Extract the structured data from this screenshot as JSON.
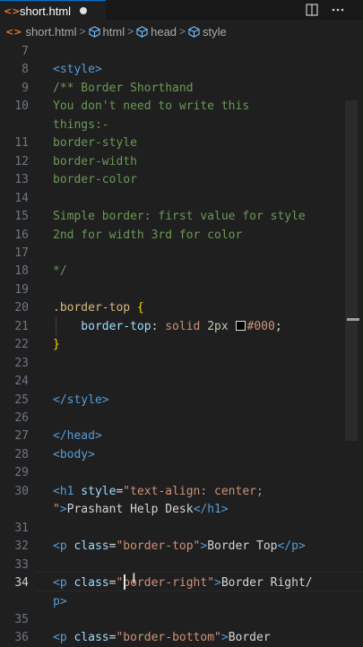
{
  "tab": {
    "filename": "short.html",
    "file_icon": "<>",
    "dirty": true
  },
  "toolbar": {
    "split_icon": "split-editor-icon",
    "more_icon": "more-actions-icon"
  },
  "breadcrumb": {
    "file_icon": "<>",
    "items": [
      "short.html",
      "html",
      "head",
      "style"
    ],
    "separator": ">"
  },
  "colors": {
    "tag": "#569cd6",
    "comment": "#6a9955",
    "selector": "#d7ba7d",
    "property": "#9cdcfe",
    "value": "#ce9178",
    "number": "#b5cea8",
    "bracket": "#ffd700",
    "text": "#d4d4d4",
    "accent": "#0078d4"
  },
  "editor": {
    "active_line": "34",
    "lines": [
      {
        "num": "7",
        "code": ""
      },
      {
        "num": "8",
        "code": "<style>"
      },
      {
        "num": "9",
        "code": "/** Border Shorthand"
      },
      {
        "num": "10",
        "code": "You don't need to write this"
      },
      {
        "num": "",
        "code": "things:-"
      },
      {
        "num": "11",
        "code": "border-style"
      },
      {
        "num": "12",
        "code": "border-width"
      },
      {
        "num": "13",
        "code": "border-color"
      },
      {
        "num": "14",
        "code": ""
      },
      {
        "num": "15",
        "code": "Simple border: first value for style"
      },
      {
        "num": "16",
        "code": "2nd for width 3rd for color"
      },
      {
        "num": "17",
        "code": ""
      },
      {
        "num": "18",
        "code": "*/"
      },
      {
        "num": "19",
        "code": ""
      },
      {
        "num": "20",
        "code": ".border-top {"
      },
      {
        "num": "21",
        "code": "    border-top: solid 2px #000;"
      },
      {
        "num": "22",
        "code": "}"
      },
      {
        "num": "23",
        "code": ""
      },
      {
        "num": "24",
        "code": ""
      },
      {
        "num": "25",
        "code": "</style>"
      },
      {
        "num": "26",
        "code": ""
      },
      {
        "num": "27",
        "code": "</head>"
      },
      {
        "num": "28",
        "code": "<body>"
      },
      {
        "num": "29",
        "code": ""
      },
      {
        "num": "30",
        "code": "<h1 style=\"text-align: center;"
      },
      {
        "num": "",
        "code": "\">Prashant Help Desk</h1>"
      },
      {
        "num": "31",
        "code": ""
      },
      {
        "num": "32",
        "code": "<p class=\"border-top\">Border Top</p>"
      },
      {
        "num": "33",
        "code": ""
      },
      {
        "num": "34",
        "code": "<p class=\"border-right\">Border Right</"
      },
      {
        "num": "",
        "code": "p>"
      },
      {
        "num": "35",
        "code": ""
      },
      {
        "num": "36",
        "code": "<p class=\"border-bottom\">Border"
      }
    ]
  }
}
